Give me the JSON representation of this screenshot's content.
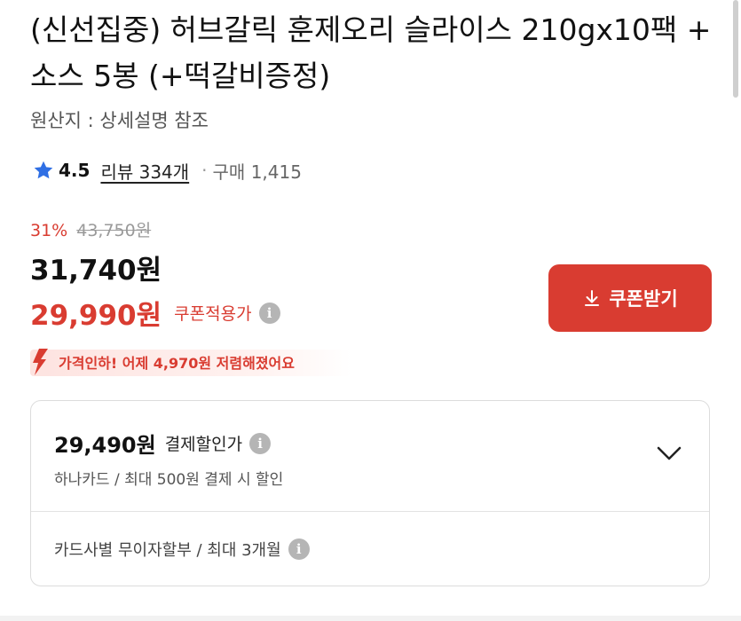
{
  "product": {
    "title": "(신선집중) 허브갈릭 훈제오리 슬라이스 210gx10팩 + 소스 5봉 (+떡갈비증정)",
    "origin": "원산지 : 상세설명 참조",
    "rating": "4.5",
    "reviews": "리뷰 334개",
    "separator": "·",
    "purchase": "구매 1,415"
  },
  "pricing": {
    "discount_pct": "31%",
    "original_price": "43,750원",
    "price": "31,740원",
    "coupon_price": "29,990원",
    "coupon_label": "쿠폰적용가",
    "coupon_button": "쿠폰받기",
    "price_drop": "가격인하! 어제 4,970원 저렴해졌어요"
  },
  "card_discount": {
    "price": "29,490원",
    "label": "결제할인가",
    "subtitle": "하나카드 / 최대 500원 결제 시 할인",
    "installment": "카드사별 무이자할부 / 최대 3개월"
  },
  "icons": {
    "info": "i"
  },
  "colors": {
    "accent": "#d93c31",
    "star": "#2f6fe4"
  }
}
